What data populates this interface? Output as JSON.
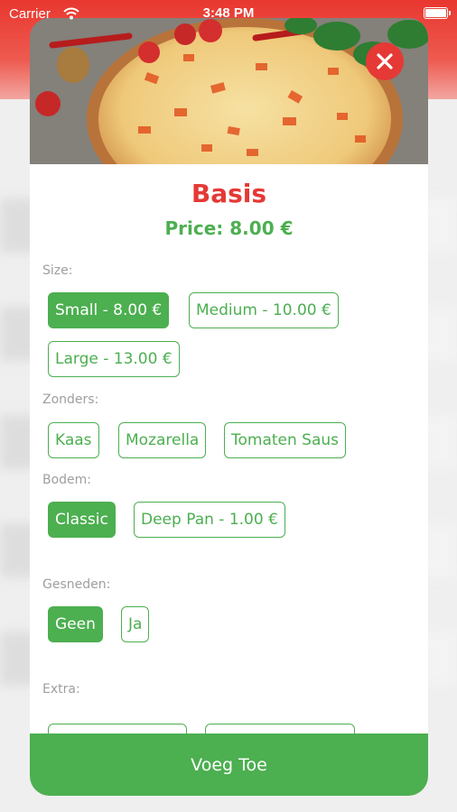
{
  "status_bar": {
    "carrier": "Carrier",
    "time": "3:48 PM"
  },
  "product": {
    "title": "Basis",
    "price": "Price: 8.00 €"
  },
  "options": {
    "size": {
      "label": "Size:",
      "choices": [
        "Small - 8.00 €",
        "Medium - 10.00 €",
        "Large - 13.00 €"
      ],
      "selected": "Small - 8.00 €"
    },
    "zonders": {
      "label": "Zonders:",
      "choices": [
        "Kaas",
        "Mozarella",
        "Tomaten Saus"
      ]
    },
    "bodem": {
      "label": "Bodem:",
      "choices": [
        "Classic",
        "Deep Pan - 1.00 €"
      ],
      "selected": "Classic"
    },
    "gesneden": {
      "label": "Gesneden:",
      "choices": [
        "Geen",
        "Ja"
      ],
      "selected": "Geen"
    },
    "extra": {
      "label": "Extra:"
    }
  },
  "add_button": {
    "label": "Voeg Toe"
  },
  "colors": {
    "accent_red": "#e53935",
    "accent_green": "#4caf50"
  },
  "icons": {
    "close": "close-icon",
    "wifi": "wifi-icon",
    "battery": "battery-icon"
  }
}
